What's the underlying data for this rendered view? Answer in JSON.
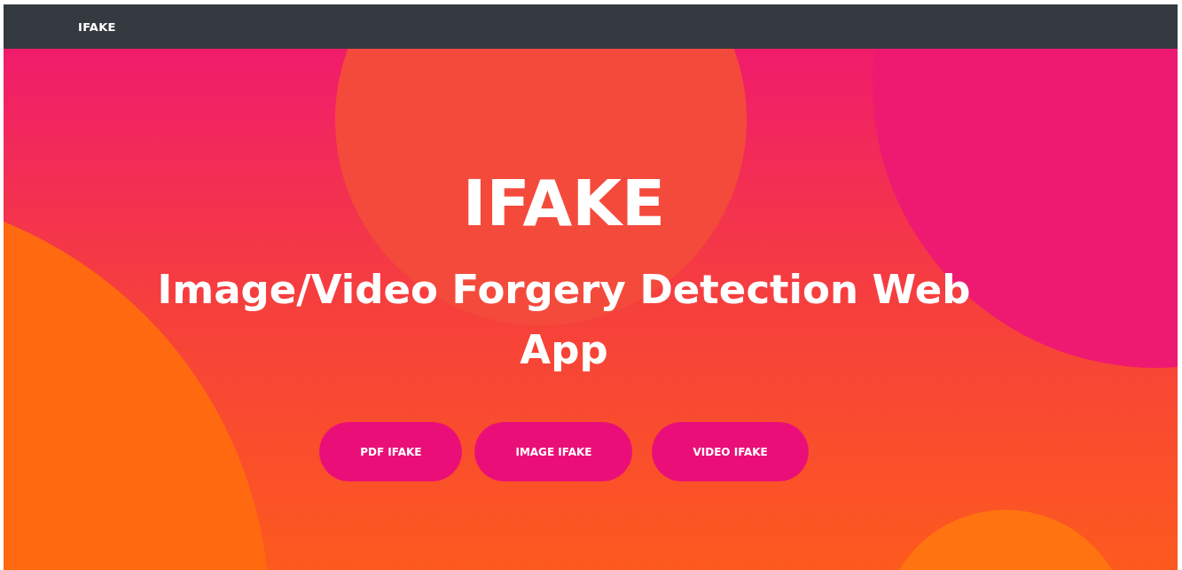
{
  "navbar": {
    "brand": "IFAKE"
  },
  "hero": {
    "title": "IFAKE",
    "subtitle": "Image/Video Forgery Detection Web App",
    "buttons": [
      {
        "label": "PDF IFAKE"
      },
      {
        "label": "IMAGE IFAKE"
      },
      {
        "label": "VIDEO IFAKE"
      }
    ]
  }
}
